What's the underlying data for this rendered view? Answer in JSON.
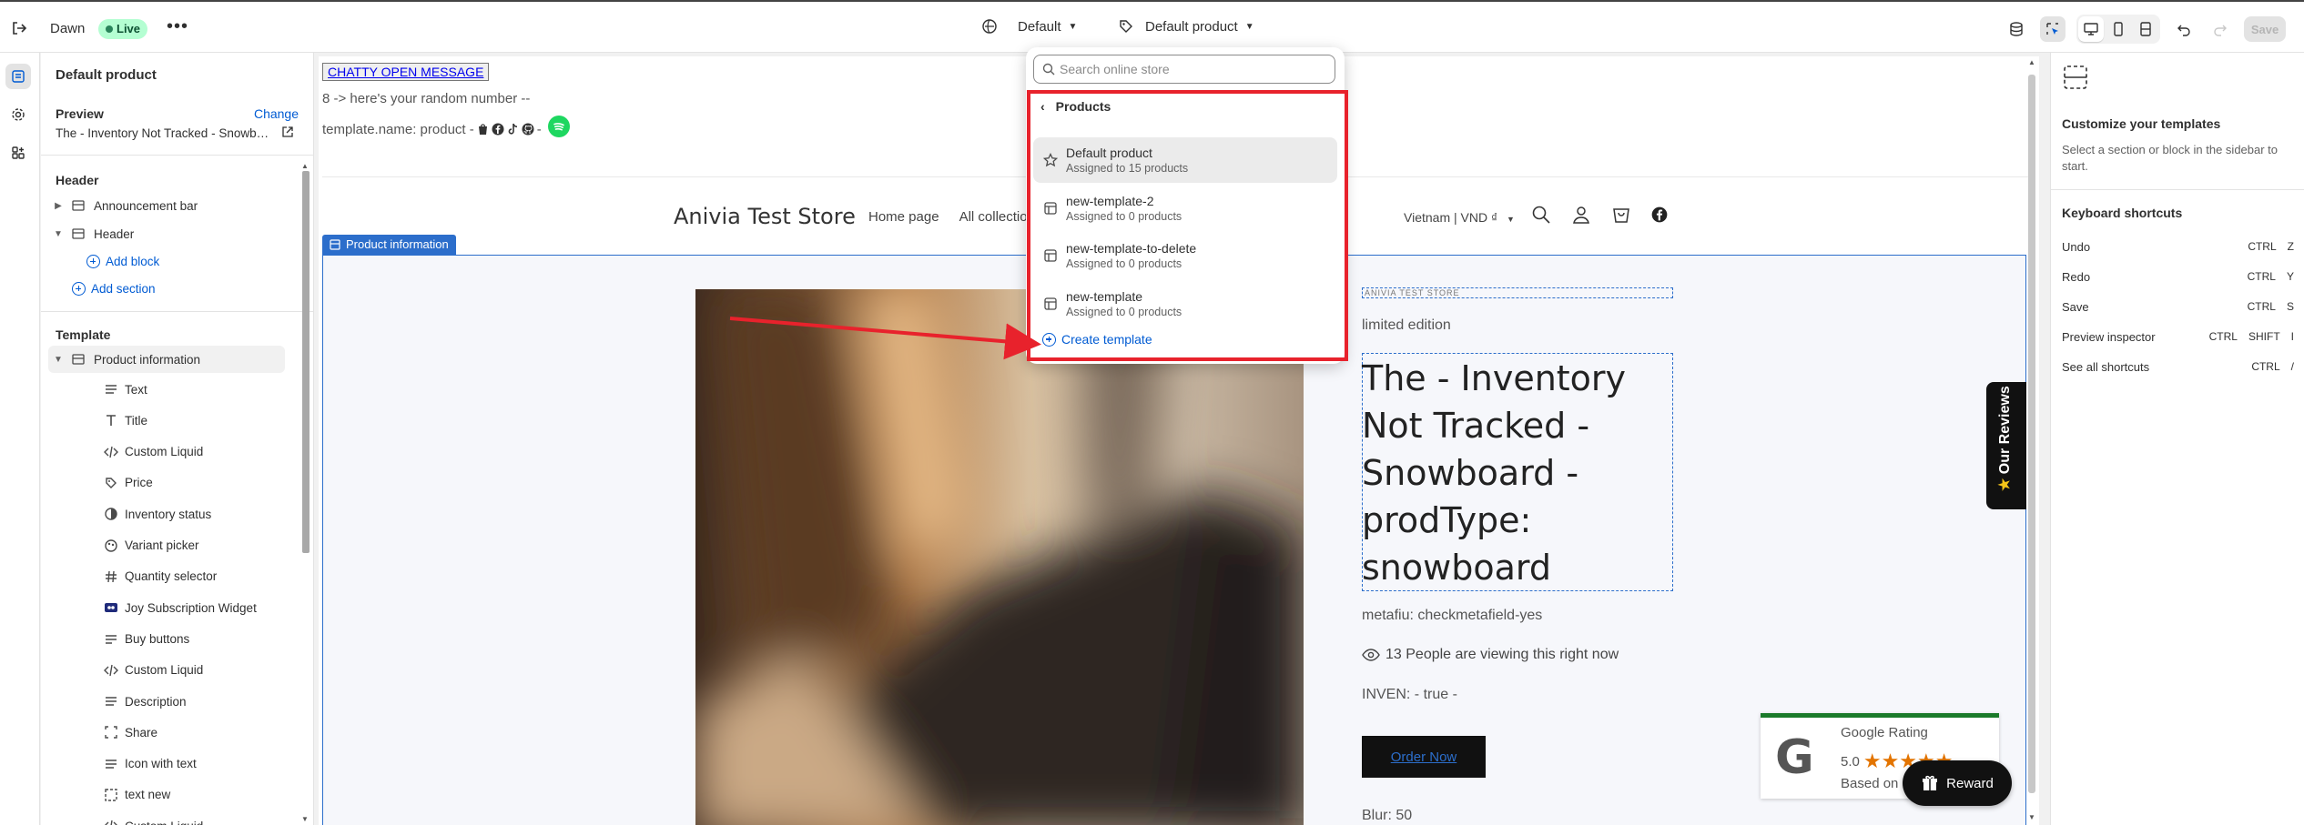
{
  "topbar": {
    "theme_name": "Dawn",
    "status_badge": "Live",
    "more": "•••",
    "theme_selector": "Default",
    "template_selector": "Default product",
    "save_label": "Save"
  },
  "sidebar": {
    "title": "Default product",
    "preview_label": "Preview",
    "change_label": "Change",
    "preview_value": "The - Inventory Not Tracked - Snowboard - prodType: snowboard",
    "header_group": "Header",
    "header_items": [
      {
        "label": "Announcement bar"
      },
      {
        "label": "Header"
      }
    ],
    "add_block": "Add block",
    "add_section": "Add section",
    "template_group": "Template",
    "template_section": "Product information",
    "blocks": [
      {
        "label": "Text",
        "icon": "text-icon"
      },
      {
        "label": "Title",
        "icon": "title-icon"
      },
      {
        "label": "Custom Liquid",
        "icon": "code-icon"
      },
      {
        "label": "Price",
        "icon": "price-tag-icon"
      },
      {
        "label": "Inventory status",
        "icon": "inventory-icon"
      },
      {
        "label": "Variant picker",
        "icon": "variant-icon"
      },
      {
        "label": "Quantity selector",
        "icon": "hash-icon"
      },
      {
        "label": "Joy Subscription Widget",
        "icon": "app-icon"
      },
      {
        "label": "Buy buttons",
        "icon": "buttons-icon"
      },
      {
        "label": "Custom Liquid",
        "icon": "code-icon"
      },
      {
        "label": "Description",
        "icon": "text-icon"
      },
      {
        "label": "Share",
        "icon": "share-icon"
      },
      {
        "label": "Icon with text",
        "icon": "text-icon"
      },
      {
        "label": "text new",
        "icon": "dashed-box-icon"
      },
      {
        "label": "Custom Liquid",
        "icon": "code-icon"
      }
    ]
  },
  "canvas": {
    "chatty_button": "CHATTY OPEN MESSAGE",
    "random_text": "8 -> here's your random number --",
    "template_name_text": "template.name: product -",
    "store_name": "Anivia Test Store",
    "nav": [
      "Home page",
      "All collection"
    ],
    "locale": "Vietnam | VND ₫",
    "section_tag": "Product information",
    "brand_small": "ANIVIA TEST STORE",
    "limited": "limited edition",
    "product_title": "The - Inventory Not Tracked - Snowboard - prodType: snowboard",
    "metafield": "metafiu: checkmetafield-yes",
    "viewing": "13 People are viewing this right now",
    "inven": "INVEN: - true -",
    "buy_button": "Order Now",
    "blur": "Blur: 50",
    "reviews_tab": "Our Reviews",
    "google": {
      "title": "Google Rating",
      "score": "5.0",
      "stars": "★★★★★",
      "based": "Based on"
    },
    "reward": "Reward"
  },
  "popup": {
    "search_placeholder": "Search online store",
    "back_label": "Products",
    "items": [
      {
        "name": "Default product",
        "sub": "Assigned to 15 products"
      },
      {
        "name": "new-template-2",
        "sub": "Assigned to 0 products"
      },
      {
        "name": "new-template-to-delete",
        "sub": "Assigned to 0 products"
      },
      {
        "name": "new-template",
        "sub": "Assigned to 0 products"
      }
    ],
    "create_label": "Create template"
  },
  "rpanel": {
    "title": "Customize your templates",
    "desc": "Select a section or block in the sidebar to start.",
    "shortcuts_title": "Keyboard shortcuts",
    "shortcuts": [
      {
        "label": "Undo",
        "keys": [
          "CTRL",
          "Z"
        ]
      },
      {
        "label": "Redo",
        "keys": [
          "CTRL",
          "Y"
        ]
      },
      {
        "label": "Save",
        "keys": [
          "CTRL",
          "S"
        ]
      },
      {
        "label": "Preview inspector",
        "keys": [
          "CTRL",
          "SHIFT",
          "I"
        ]
      },
      {
        "label": "See all shortcuts",
        "keys": [
          "CTRL",
          "/"
        ]
      }
    ]
  },
  "colors": {
    "accent": "#005bd3",
    "highlight": "#e8222c",
    "section": "#2c6ecb",
    "live": "#b4fed2"
  }
}
